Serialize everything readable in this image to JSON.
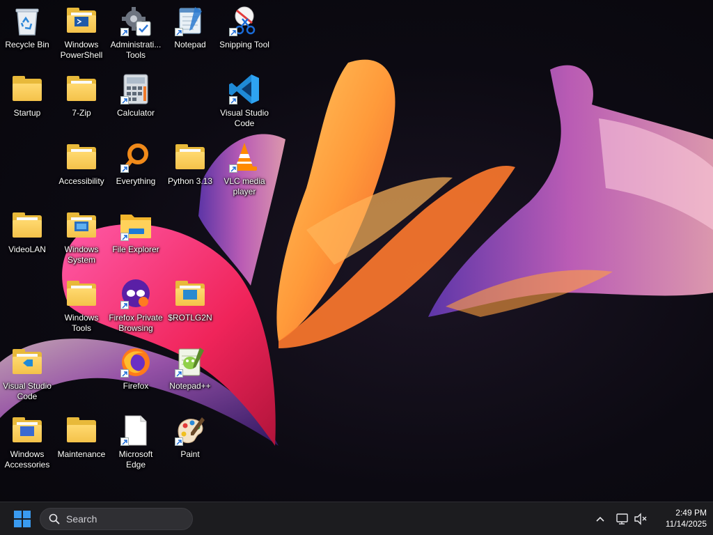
{
  "desktop": {
    "icons": [
      {
        "label": "Recycle Bin",
        "icon": "recycle-bin-icon"
      },
      {
        "label": "Windows PowerShell",
        "icon": "folder-icon"
      },
      {
        "label": "Administrati... Tools",
        "icon": "administrative-tools-icon"
      },
      {
        "label": "Notepad",
        "icon": "notepad-icon"
      },
      {
        "label": "Snipping Tool",
        "icon": "snipping-tool-icon"
      },
      {
        "label": "Startup",
        "icon": "folder-icon"
      },
      {
        "label": "7-Zip",
        "icon": "folder-icon"
      },
      {
        "label": "Calculator",
        "icon": "calculator-icon"
      },
      {
        "label": "Visual Studio Code",
        "icon": "vscode-icon"
      },
      {
        "label": "Accessibility",
        "icon": "folder-icon"
      },
      {
        "label": "Everything",
        "icon": "everything-search-icon"
      },
      {
        "label": "Python 3.13",
        "icon": "folder-icon"
      },
      {
        "label": "VLC media player",
        "icon": "vlc-icon"
      },
      {
        "label": "VideoLAN",
        "icon": "folder-icon"
      },
      {
        "label": "Windows System",
        "icon": "folder-icon"
      },
      {
        "label": "File Explorer",
        "icon": "file-explorer-icon"
      },
      {
        "label": "Windows Tools",
        "icon": "folder-icon"
      },
      {
        "label": "Firefox Private Browsing",
        "icon": "firefox-private-icon"
      },
      {
        "label": "$ROTLG2N",
        "icon": "folder-icon"
      },
      {
        "label": "Visual Studio Code",
        "icon": "folder-icon"
      },
      {
        "label": "Firefox",
        "icon": "firefox-icon"
      },
      {
        "label": "Notepad++",
        "icon": "notepadpp-icon"
      },
      {
        "label": "Windows Accessories",
        "icon": "folder-icon"
      },
      {
        "label": "Maintenance",
        "icon": "folder-icon"
      },
      {
        "label": "Microsoft Edge",
        "icon": "blank-file-icon"
      },
      {
        "label": "Paint",
        "icon": "paint-icon"
      }
    ]
  },
  "taskbar": {
    "search_placeholder": "Search",
    "clock_time": "2:49 PM",
    "clock_date": "11/14/2025"
  },
  "colors": {
    "taskbar_bg": "#1c1c1f",
    "folder_yellow": "#f4c24a",
    "windows_blue": "#3a9bf0"
  }
}
